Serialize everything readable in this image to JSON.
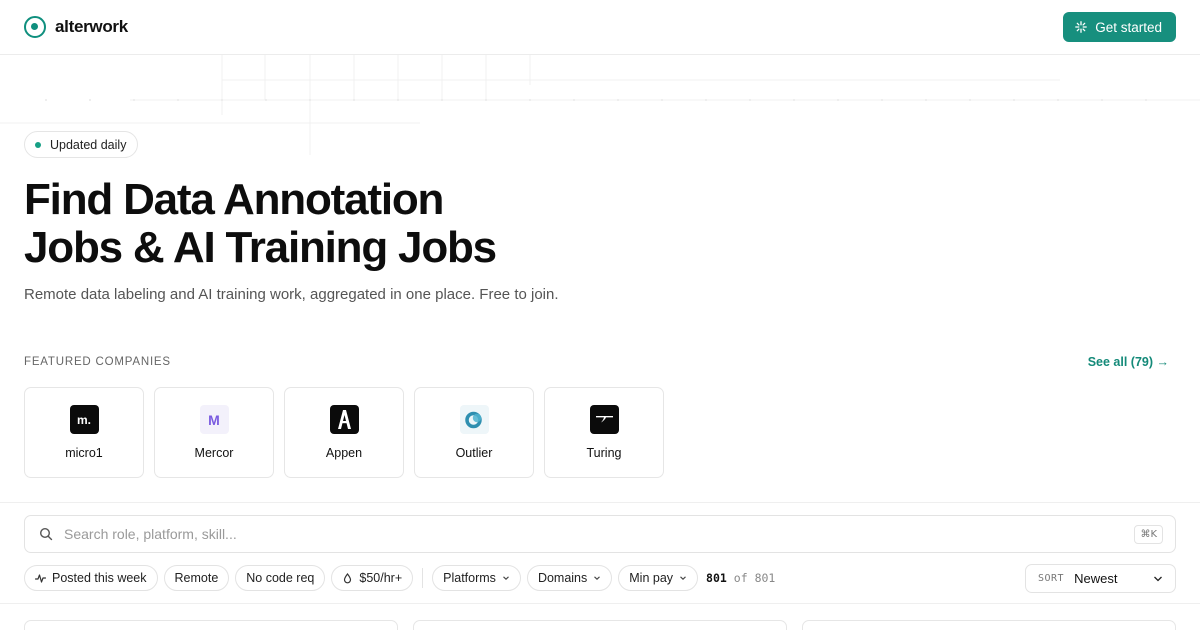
{
  "header": {
    "brand": "alterwork",
    "cta_label": "Get started"
  },
  "hero": {
    "badge": "Updated daily",
    "title_line1": "Find Data Annotation",
    "title_line2": "Jobs & AI Training Jobs",
    "subtitle": "Remote data labeling and AI training work, aggregated in one place. Free to join."
  },
  "featured": {
    "label": "FEATURED COMPANIES",
    "see_all": "See all (79) →",
    "companies": [
      {
        "name": "micro1",
        "icon": "micro1-logo",
        "mark": "m."
      },
      {
        "name": "Mercor",
        "icon": "mercor-logo",
        "mark": "M"
      },
      {
        "name": "Appen",
        "icon": "appen-logo"
      },
      {
        "name": "Outlier",
        "icon": "outlier-logo"
      },
      {
        "name": "Turing",
        "icon": "turing-logo"
      }
    ]
  },
  "search": {
    "placeholder": "Search role, platform, skill...",
    "shortcut": "⌘K"
  },
  "filters": {
    "chips": [
      "Posted this week",
      "Remote",
      "No code req",
      "$50/hr+"
    ],
    "dropdowns": [
      "Platforms",
      "Domains",
      "Min pay"
    ],
    "count_shown": "801",
    "count_of": "of",
    "count_total": "801"
  },
  "sort": {
    "label": "SORT",
    "value": "Newest"
  },
  "colors": {
    "accent": "#178f7e",
    "accent_text": "#148a79"
  }
}
